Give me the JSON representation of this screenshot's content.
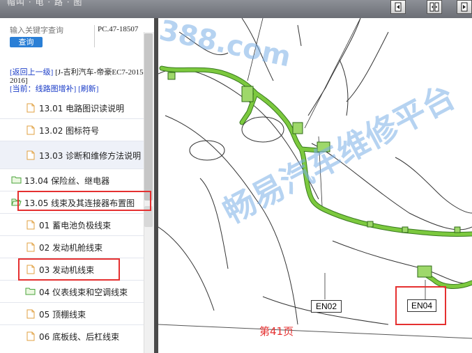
{
  "window": {
    "title": "帽叫 · 电 · 路 · 图"
  },
  "search": {
    "placeholder": "输入关键字查询",
    "button": "查询"
  },
  "doc_code": "PC.47-18507",
  "nav": {
    "back": "[返回上一级]",
    "path": "[J-吉利汽车-帝豪EC7-2015-2016]",
    "current": "[当前：线路图增补]",
    "refresh": "[刷新]"
  },
  "tree": [
    {
      "label": "13.01 电路图识读说明",
      "type": "doc"
    },
    {
      "label": "13.02 图标符号",
      "type": "doc"
    },
    {
      "label": "13.03 诊断和维修方法说明",
      "type": "doc",
      "selected": true
    },
    {
      "label": "13.04 保险丝、继电器",
      "type": "folder"
    },
    {
      "label": "13.05 线束及其连接器布置图",
      "type": "folder-open",
      "highlighted": true
    },
    {
      "label": "01 蓄电池负极线束",
      "type": "doc"
    },
    {
      "label": "02 发动机舱线束",
      "type": "doc"
    },
    {
      "label": "03 发动机线束",
      "type": "doc",
      "highlighted": true
    },
    {
      "label": "04 仪表线束和空调线束",
      "type": "folder"
    },
    {
      "label": "05 顶棚线束",
      "type": "doc"
    },
    {
      "label": "06 底板线、后杠线束",
      "type": "doc"
    }
  ],
  "diagram": {
    "connectors": [
      "EN02",
      "EN04"
    ],
    "page_label": "第41页",
    "watermark_site": "388.com",
    "watermark_text": "畅易汽车维修平台"
  },
  "colors": {
    "harness": "#79c83a",
    "highlight": "#e53030",
    "link": "#1a3cc8",
    "button": "#2a7fd6"
  }
}
